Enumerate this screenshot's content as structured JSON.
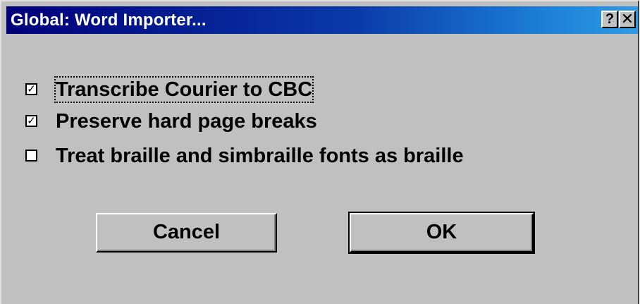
{
  "window": {
    "title": "Global: Word Importer...",
    "help_glyph": "?",
    "close_glyph": "✕"
  },
  "options": [
    {
      "label": "Transcribe Courier to CBC",
      "checked": true,
      "mark": "✓",
      "focused": true
    },
    {
      "label": "Preserve hard page breaks",
      "checked": true,
      "mark": "✓",
      "focused": false
    },
    {
      "label": "Treat braille and simbraille fonts as braille",
      "checked": false,
      "mark": "",
      "focused": false
    }
  ],
  "buttons": {
    "cancel": "Cancel",
    "ok": "OK"
  }
}
